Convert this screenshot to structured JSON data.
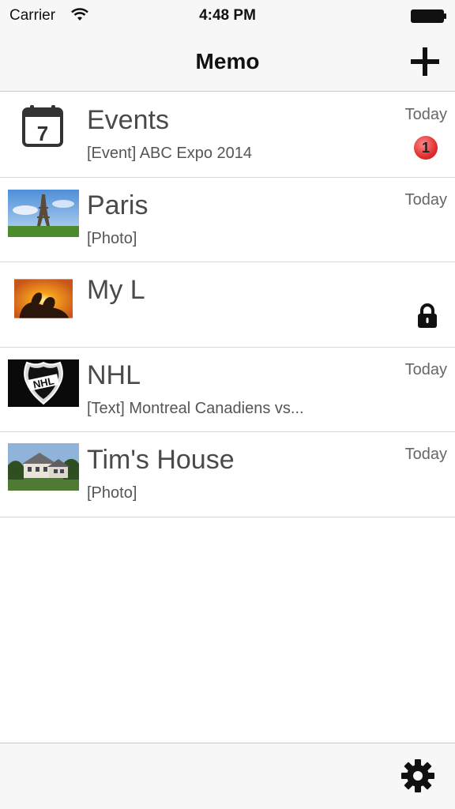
{
  "status_bar": {
    "carrier": "Carrier",
    "time": "4:48 PM"
  },
  "nav": {
    "title": "Memo",
    "add_icon": "plus-icon"
  },
  "memos": [
    {
      "title": "Events",
      "subtitle": "[Event] ABC Expo 2014",
      "date": "Today",
      "badge": "1",
      "thumb": "calendar-icon",
      "calendar_day": "7"
    },
    {
      "title": "Paris",
      "subtitle": "[Photo]",
      "date": "Today",
      "thumb": "eiffel-tower-photo"
    },
    {
      "title": "My L",
      "subtitle": "",
      "date": "",
      "locked": true,
      "thumb": "silhouette-couple-photo"
    },
    {
      "title": "NHL",
      "subtitle": "[Text] Montreal Canadiens vs...",
      "date": "Today",
      "thumb": "nhl-logo",
      "logo_text": "NHL"
    },
    {
      "title": "Tim's House",
      "subtitle": "[Photo]",
      "date": "Today",
      "thumb": "house-photo"
    }
  ],
  "tab_bar": {
    "settings_icon": "gear-icon"
  },
  "colors": {
    "bar_background": "#f7f7f7",
    "badge_red": "#e03030",
    "separator": "#d6d6d6"
  }
}
